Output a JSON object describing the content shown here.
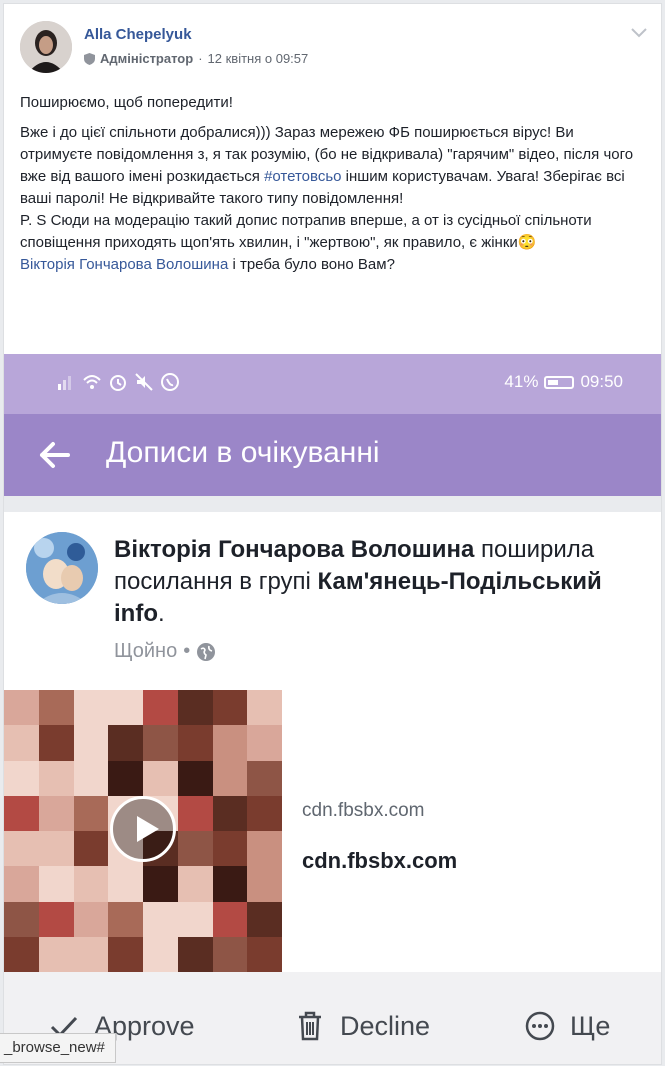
{
  "post": {
    "author": "Alla Chepelyuk",
    "role": "Адміністратор",
    "timestamp": "12 квітня о 09:57",
    "intro": "Поширюємо, щоб попередити!",
    "body_part1": "Вже і до цієї спільноти добралися))) Зараз мережею ФБ поширюється вірус! Ви отримуєте повідомлення з, я так розумію, (бо не відкривала) \"гарячим\" відео, після чого вже від вашого імені розкидається ",
    "hashtag": "#отетовсьо",
    "body_part2": " іншим користувачам. Увага! Зберігає всі ваші паролі! Не відкривайте такого типу повідомлення!",
    "ps": "P. S Сюди на модерацію такий допис потрапив вперше, а от із сусідньої спільноти сповіщення приходять щоп'ять хвилин, і \"жертвою\", як правило, є жінки😳",
    "mention": "Вікторія Гончарова Волошина",
    "mention_tail": " і треба було воно Вам?"
  },
  "screenshot": {
    "status_right": "41%",
    "status_time": "09:50",
    "toolbar_title": "Дописи в очікуванні",
    "card": {
      "name": "Вікторія Гончарова Волошина",
      "action_text": " поширила посилання в групі ",
      "group": "Кам'янець-Подільський info",
      "period": ".",
      "time": "Щойно",
      "separator": "•",
      "link_domain": "cdn.fbsbx.com",
      "link_title": "cdn.fbsbx.com"
    },
    "actions": {
      "approve": "Approve",
      "decline": "Decline",
      "more": "Ще"
    }
  },
  "tooltip": "_browse_new#",
  "colors": {
    "link": "#365899",
    "status_bar": "#b8a6d9",
    "toolbar": "#9b86c8"
  }
}
